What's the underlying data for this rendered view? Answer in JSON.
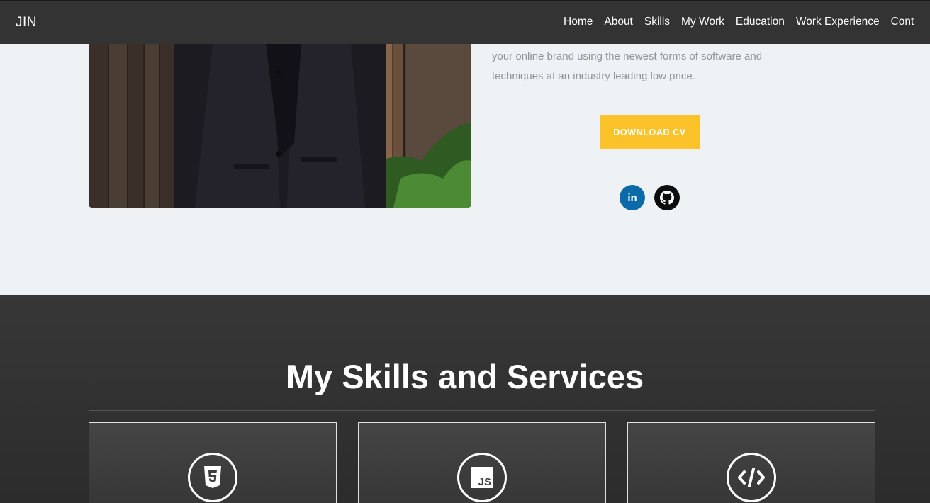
{
  "navbar": {
    "brand": "JIN",
    "links": [
      "Home",
      "About",
      "Skills",
      "My Work",
      "Education",
      "Work Experience",
      "Cont"
    ]
  },
  "hero": {
    "intro_line1": "your online brand using the newest forms of software and",
    "intro_line2": "techniques at an industry leading low price.",
    "download_label": "DOWNLOAD CV",
    "social": [
      {
        "name": "linkedin-icon",
        "glyph": "in",
        "color": "#0b6ba8"
      },
      {
        "name": "github-icon",
        "color": "#0d0d0d"
      }
    ]
  },
  "skills": {
    "title": "My Skills and Services",
    "cards": [
      {
        "icon": "html5-icon"
      },
      {
        "icon": "javascript-icon",
        "glyph": "JS"
      },
      {
        "icon": "code-icon"
      }
    ]
  },
  "colors": {
    "navbar_bg": "#333333",
    "hero_bg": "#eff2f5",
    "accent": "#fcc22a",
    "skills_bg": "#333333"
  }
}
